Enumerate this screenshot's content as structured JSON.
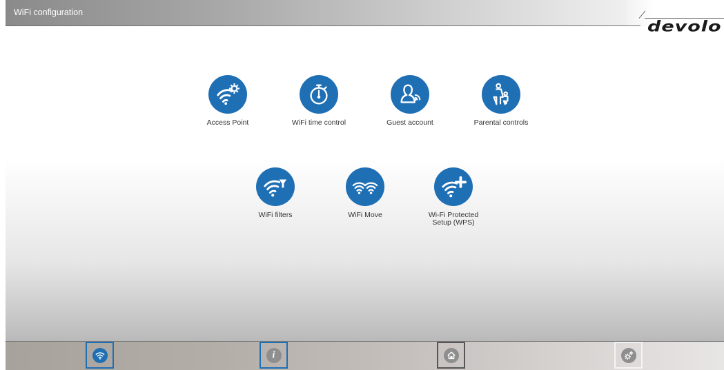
{
  "header": {
    "title": "WiFi configuration",
    "brand": "devolo"
  },
  "colors": {
    "accent": "#1f6fb5",
    "nav_grey": "#8e8e8e"
  },
  "tiles": [
    {
      "label": "Access Point",
      "icon": "wifi-gear-icon"
    },
    {
      "label": "WiFi time control",
      "icon": "stopwatch-icon"
    },
    {
      "label": "Guest account",
      "icon": "guest-user-icon"
    },
    {
      "label": "Parental controls",
      "icon": "parent-child-icon"
    },
    {
      "label": "WiFi filters",
      "icon": "wifi-filter-icon"
    },
    {
      "label": "WiFi Move",
      "icon": "wifi-move-icon"
    },
    {
      "label": "Wi-Fi Protected Setup (WPS)",
      "icon": "wifi-plus-icon"
    }
  ],
  "bottom_nav": [
    {
      "name": "wifi",
      "icon": "wifi-icon",
      "active": true
    },
    {
      "name": "info",
      "icon": "info-icon",
      "active": false
    },
    {
      "name": "home",
      "icon": "home-icon",
      "active": false
    },
    {
      "name": "settings",
      "icon": "settings-gear-icon",
      "active": false
    }
  ]
}
